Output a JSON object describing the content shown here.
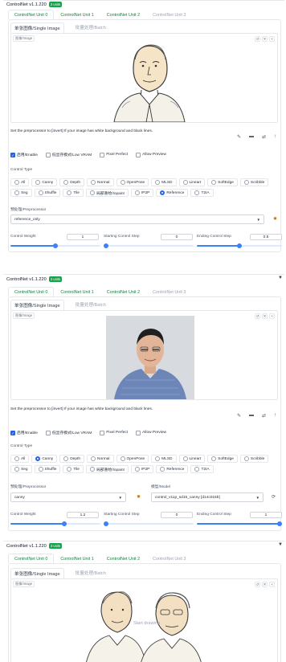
{
  "panels": [
    {
      "header": {
        "title": "ControlNet v1.1.220",
        "badge": "3 units"
      },
      "unit_tabs": [
        "ControlNet Unit 0",
        "ControlNet Unit 1",
        "ControlNet Unit 2",
        "ControlNet Unit 3"
      ],
      "image_tabs": [
        "单张图像/Single Image",
        "批量处理/Batch"
      ],
      "image_label": "图像/Image",
      "hint": "Set the preprocessor to [invert] If your image has white background and black lines.",
      "checks": [
        "启用/Enable",
        "低显存模式/Low VRAM",
        "Pixel Perfect",
        "Allow Preview"
      ],
      "control_type_label": "Control Type",
      "control_types": [
        "All",
        "Canny",
        "Depth",
        "Normal",
        "OpenPose",
        "MLSD",
        "Lineart",
        "SoftEdge",
        "Scribble",
        "Seg",
        "Shuffle",
        "Tile",
        "局部重绘/Inpaint",
        "IP2P",
        "Reference",
        "T2IA"
      ],
      "selected_type": "Reference",
      "preprocessor_label": "预处理/Preprocessor",
      "preprocessor_value": "reference_only",
      "sliders": {
        "weight_label": "Control Weight",
        "weight_value": "1",
        "start_label": "Starting Control Step",
        "start_value": "0",
        "end_label": "Ending Control Step",
        "end_value": "0.5"
      }
    },
    {
      "header": {
        "title": "ControlNet v1.1.220",
        "badge": "3 units"
      },
      "unit_tabs": [
        "ControlNet Unit 0",
        "ControlNet Unit 1",
        "ControlNet Unit 2",
        "ControlNet Unit 3"
      ],
      "image_tabs": [
        "单张图像/Single Image",
        "批量处理/Batch"
      ],
      "image_label": "图像/Image",
      "hint": "Set the preprocessor to [invert] If your image has white background and black lines.",
      "checks": [
        "启用/Enable",
        "低显存模式/Low VRAM",
        "Pixel Perfect",
        "Allow Preview"
      ],
      "control_type_label": "Control Type",
      "control_types": [
        "All",
        "Canny",
        "Depth",
        "Normal",
        "OpenPose",
        "MLSD",
        "Lineart",
        "SoftEdge",
        "Scribble",
        "Seg",
        "Shuffle",
        "Tile",
        "局部重绘/Inpaint",
        "IP2P",
        "Reference",
        "T2IA"
      ],
      "selected_type": "Canny",
      "preprocessor_label": "预处理/Preprocessor",
      "preprocessor_value": "canny",
      "model_label": "模型/Model",
      "model_value": "control_v11p_sd15_canny [d14c016b]",
      "sliders": {
        "weight_label": "Control Weight",
        "weight_value": "1.2",
        "start_label": "Starting Control Step",
        "start_value": "0",
        "end_label": "Ending Control Step",
        "end_value": "1"
      }
    },
    {
      "header": {
        "title": "ControlNet v1.1.220",
        "badge": "3 units"
      },
      "unit_tabs": [
        "ControlNet Unit 0",
        "ControlNet Unit 1",
        "ControlNet Unit 2",
        "ControlNet Unit 3"
      ],
      "image_tabs": [
        "单张图像/Single Image",
        "批量处理/Batch"
      ],
      "image_label": "图像/Image",
      "overlay_text": "Start drawing"
    }
  ],
  "colors": {
    "accent": "#2563eb",
    "green": "#15803d",
    "badge": "#16a34a",
    "spark": "#d97706"
  }
}
